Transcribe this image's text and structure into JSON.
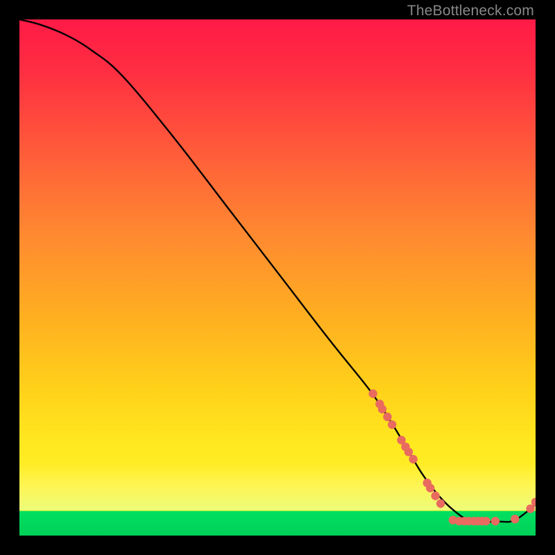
{
  "watermark": "TheBottleneck.com",
  "chart_data": {
    "type": "line",
    "title": "",
    "xlabel": "",
    "ylabel": "",
    "xlim": [
      0,
      100
    ],
    "ylim": [
      0,
      100
    ],
    "series": [
      {
        "name": "bottleneck-curve",
        "x": [
          0,
          4,
          9,
          14,
          20,
          30,
          40,
          50,
          60,
          68,
          72,
          75,
          78,
          81,
          84,
          87,
          90,
          93,
          96,
          100
        ],
        "y": [
          100,
          99,
          97,
          94,
          89,
          77,
          64,
          51,
          38,
          28,
          22,
          17,
          12,
          8,
          5,
          3,
          2.7,
          2.7,
          3,
          6
        ]
      }
    ],
    "scatter_points": {
      "name": "bottleneck-markers",
      "color": "#e96a5f",
      "points": [
        {
          "x": 68.5,
          "y": 27.5
        },
        {
          "x": 69.8,
          "y": 25.5
        },
        {
          "x": 70.3,
          "y": 24.5
        },
        {
          "x": 71.3,
          "y": 23.0
        },
        {
          "x": 72.2,
          "y": 21.5
        },
        {
          "x": 74.0,
          "y": 18.5
        },
        {
          "x": 74.8,
          "y": 17.2
        },
        {
          "x": 75.4,
          "y": 16.2
        },
        {
          "x": 76.3,
          "y": 14.8
        },
        {
          "x": 79.0,
          "y": 10.2
        },
        {
          "x": 79.6,
          "y": 9.2
        },
        {
          "x": 80.6,
          "y": 7.7
        },
        {
          "x": 81.6,
          "y": 6.2
        },
        {
          "x": 84.0,
          "y": 3.0
        },
        {
          "x": 85.2,
          "y": 2.8
        },
        {
          "x": 86.2,
          "y": 2.8
        },
        {
          "x": 87.0,
          "y": 2.8
        },
        {
          "x": 88.0,
          "y": 2.8
        },
        {
          "x": 88.8,
          "y": 2.8
        },
        {
          "x": 89.6,
          "y": 2.8
        },
        {
          "x": 90.4,
          "y": 2.8
        },
        {
          "x": 92.2,
          "y": 2.8
        },
        {
          "x": 96.0,
          "y": 3.2
        },
        {
          "x": 99.0,
          "y": 5.2
        },
        {
          "x": 100.0,
          "y": 6.5
        }
      ]
    },
    "gradient_stops": {
      "top": "#ff1a46",
      "mid": "#ffd21a",
      "green_band": "#00e060"
    }
  }
}
